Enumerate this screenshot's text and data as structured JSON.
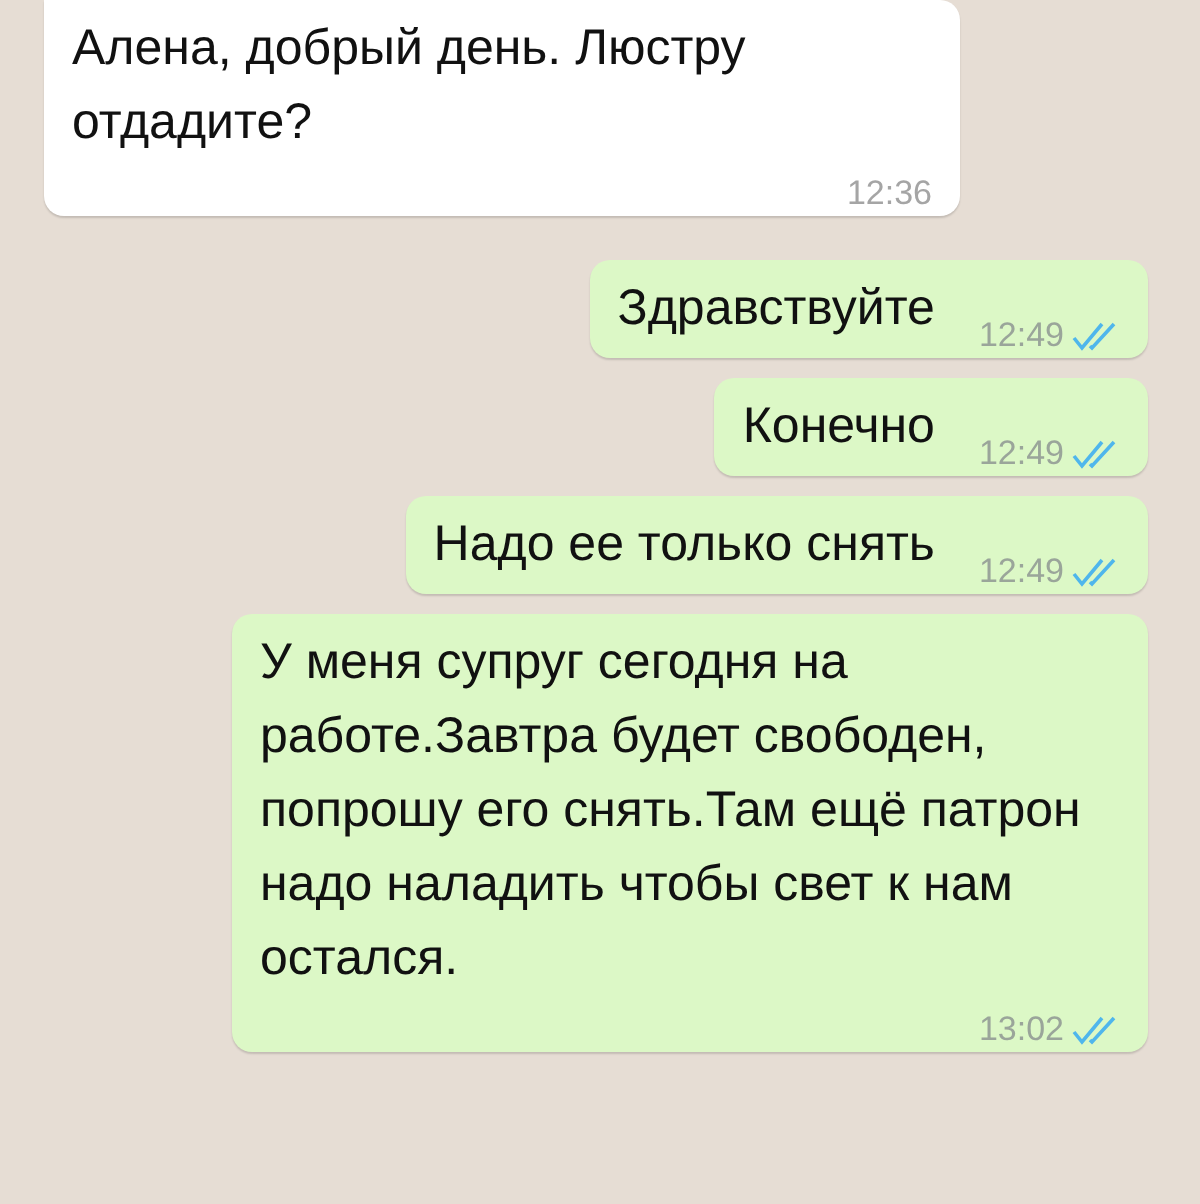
{
  "messages": [
    {
      "kind": "incoming",
      "text": "Алена, добрый день. Люстру отдадите?",
      "time": "12:36"
    },
    {
      "kind": "outgoing",
      "text": "Здравствуйте",
      "time": "12:49",
      "read": true
    },
    {
      "kind": "outgoing",
      "text": "Конечно",
      "time": "12:49",
      "read": true
    },
    {
      "kind": "outgoing",
      "text": "Надо ее только снять",
      "time": "12:49",
      "read": true
    },
    {
      "kind": "outgoing",
      "text": "У меня супруг сегодня на работе.Завтра будет свободен, попрошу его снять.Там ещё патрон надо наладить чтобы свет к нам остался.",
      "time": "13:02",
      "read": true
    }
  ]
}
